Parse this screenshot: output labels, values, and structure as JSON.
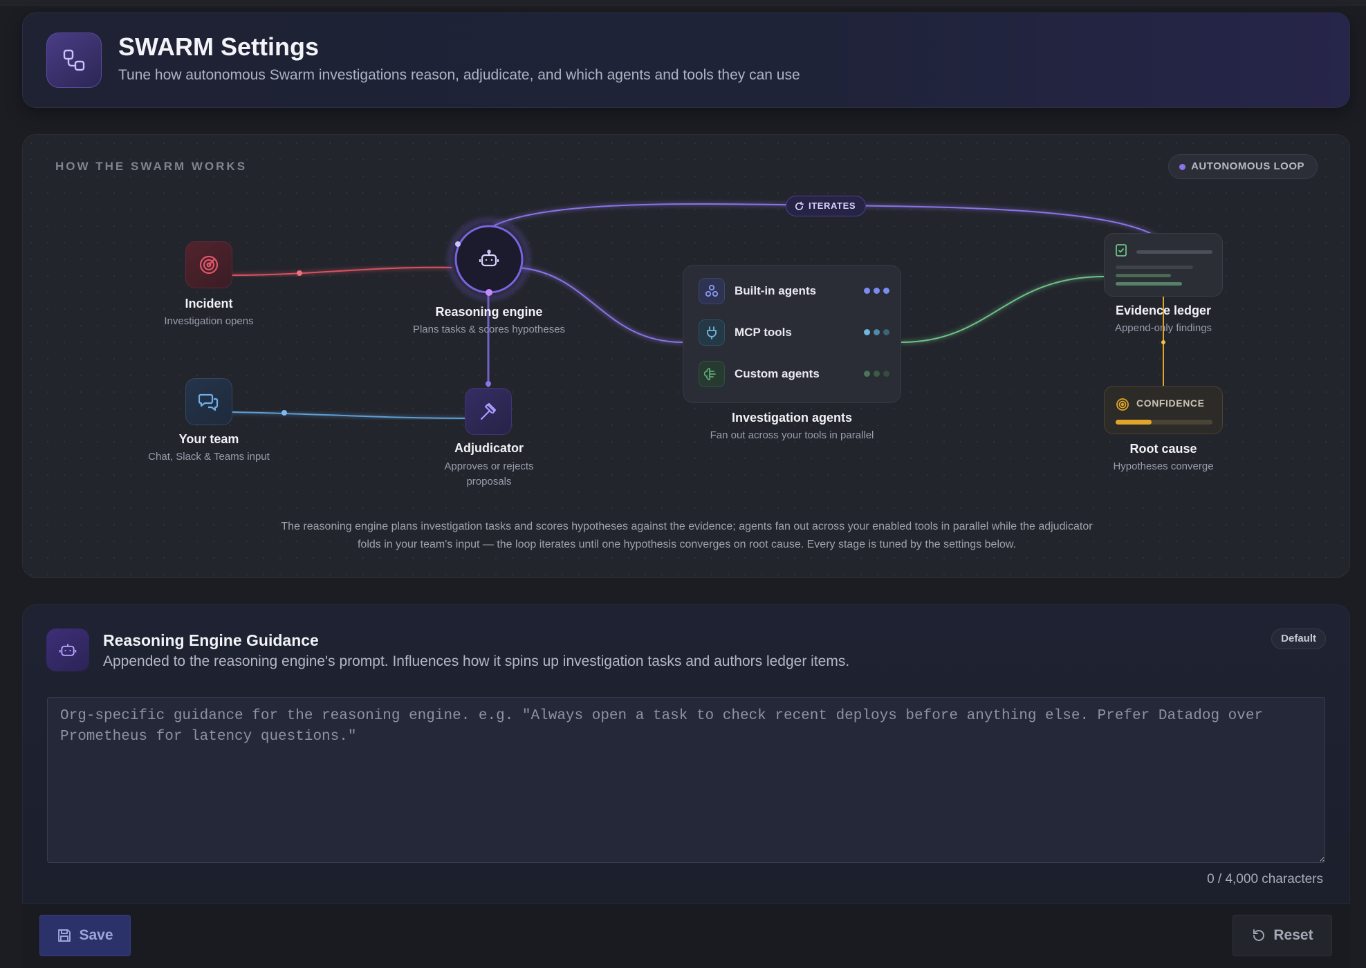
{
  "header": {
    "title": "SWARM Settings",
    "subtitle": "Tune how autonomous Swarm investigations reason, adjudicate, and which agents and tools they can use",
    "icon": "workflow-icon"
  },
  "diagram": {
    "heading": "HOW THE SWARM WORKS",
    "loop_badge": "AUTONOMOUS LOOP",
    "iterates_label": "ITERATES",
    "nodes": {
      "incident": {
        "title": "Incident",
        "subtitle": "Investigation opens",
        "icon": "target-icon"
      },
      "reasoning": {
        "title": "Reasoning engine",
        "subtitle": "Plans tasks & scores hypotheses",
        "icon": "bot-icon"
      },
      "team": {
        "title": "Your team",
        "subtitle": "Chat, Slack & Teams input",
        "icon": "chat-bubbles-icon"
      },
      "adjudicator": {
        "title": "Adjudicator",
        "subtitle": "Approves or rejects proposals",
        "icon": "gavel-icon"
      },
      "agents": {
        "title": "Investigation agents",
        "subtitle": "Fan out across your tools in parallel",
        "rows": [
          {
            "label": "Built-in agents",
            "icon": "network-icon",
            "color": "#7b8cf0"
          },
          {
            "label": "MCP tools",
            "icon": "plug-icon",
            "color": "#6fb6e0"
          },
          {
            "label": "Custom agents",
            "icon": "brain-icon",
            "color": "#5fa476"
          }
        ]
      },
      "ledger": {
        "title": "Evidence ledger",
        "subtitle": "Append-only findings",
        "icon": "checklist-icon"
      },
      "root_cause": {
        "title": "Root cause",
        "subtitle": "Hypotheses converge",
        "confidence_label": "CONFIDENCE",
        "icon": "target-icon",
        "confidence": 0.37
      }
    },
    "description": "The reasoning engine plans investigation tasks and scores hypotheses against the evidence; agents fan out across your enabled tools in parallel while the adjudicator folds in your team's input — the loop iterates until one hypothesis converges on root cause. Every stage is tuned by the settings below."
  },
  "guidance": {
    "title": "Reasoning Engine Guidance",
    "subtitle": "Appended to the reasoning engine's prompt. Influences how it spins up investigation tasks and authors ledger items.",
    "badge": "Default",
    "value": "",
    "placeholder": "Org-specific guidance for the reasoning engine. e.g. \"Always open a task to check recent deploys before anything else. Prefer Datadog over Prometheus for latency questions.\"",
    "char_count": "0 / 4,000 characters"
  },
  "footer": {
    "save_label": "Save",
    "reset_label": "Reset"
  },
  "colors": {
    "accent": "#8a74e8",
    "incident": "#e0566a",
    "team": "#5e9fd6",
    "evidence": "#6fc28a",
    "confidence": "#e0a52a"
  }
}
